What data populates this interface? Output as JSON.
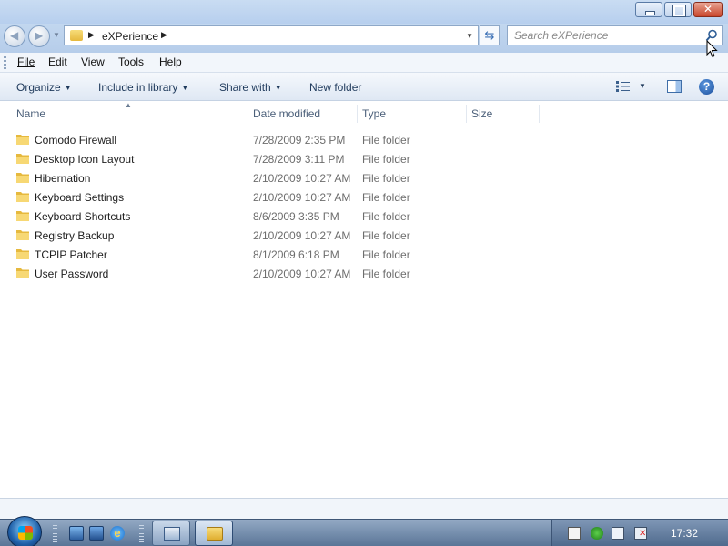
{
  "window": {
    "caption": {
      "minimize": "minimize",
      "maximize": "maximize",
      "close": "close"
    }
  },
  "navigation": {
    "address": {
      "path": [
        "eXPerience"
      ]
    },
    "search": {
      "placeholder": "Search eXPerience"
    }
  },
  "menubar": {
    "items": [
      {
        "label": "File",
        "accel": "F"
      },
      {
        "label": "Edit",
        "accel": "E"
      },
      {
        "label": "View",
        "accel": "V"
      },
      {
        "label": "Tools",
        "accel": "T"
      },
      {
        "label": "Help",
        "accel": "H"
      }
    ]
  },
  "toolbar": {
    "organize": "Organize",
    "include_in_library": "Include in library",
    "share_with": "Share with",
    "new_folder": "New folder"
  },
  "columns": {
    "name": "Name",
    "date_modified": "Date modified",
    "type": "Type",
    "size": "Size"
  },
  "files": [
    {
      "name": "Comodo Firewall",
      "date": "7/28/2009 2:35 PM",
      "type": "File folder",
      "size": ""
    },
    {
      "name": "Desktop Icon Layout",
      "date": "7/28/2009 3:11 PM",
      "type": "File folder",
      "size": ""
    },
    {
      "name": "Hibernation",
      "date": "2/10/2009 10:27 AM",
      "type": "File folder",
      "size": ""
    },
    {
      "name": "Keyboard Settings",
      "date": "2/10/2009 10:27 AM",
      "type": "File folder",
      "size": ""
    },
    {
      "name": "Keyboard Shortcuts",
      "date": "8/6/2009 3:35 PM",
      "type": "File folder",
      "size": ""
    },
    {
      "name": "Registry Backup",
      "date": "2/10/2009 10:27 AM",
      "type": "File folder",
      "size": ""
    },
    {
      "name": "TCPIP Patcher",
      "date": "8/1/2009 6:18 PM",
      "type": "File folder",
      "size": ""
    },
    {
      "name": "User Password",
      "date": "2/10/2009 10:27 AM",
      "type": "File folder",
      "size": ""
    }
  ],
  "taskbar": {
    "clock": "17:32"
  },
  "colors": {
    "accent": "#1e395b",
    "muted_text": "#6d6d6d",
    "folder": "#f0c84a"
  }
}
